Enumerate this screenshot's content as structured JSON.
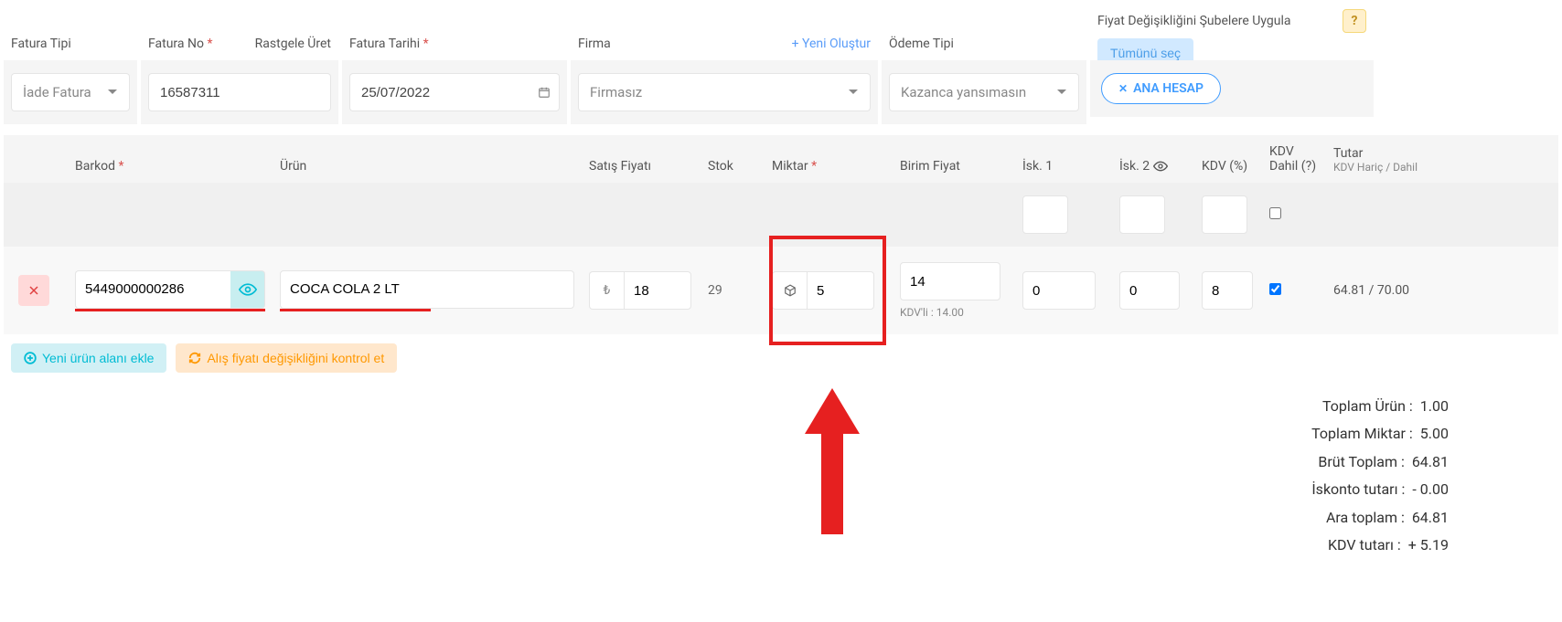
{
  "form": {
    "fatura_tipi_label": "Fatura Tipi",
    "fatura_tipi_value": "İade Fatura",
    "fatura_no_label": "Fatura No",
    "rastgele_uret": "Rastgele Üret",
    "fatura_no_value": "16587311",
    "fatura_tarihi_label": "Fatura Tarihi",
    "fatura_tarihi_value": "25/07/2022",
    "firma_label": "Firma",
    "yeni_olustur": "+ Yeni Oluştur",
    "firma_placeholder": "Firmasız",
    "odeme_tipi_label": "Ödeme Tipi",
    "odeme_tipi_value": "Kazanca yansımasın",
    "fiyat_degisikligi": "Fiyat Değişikliğini Şubelere Uygula",
    "tumunu_sec": "Tümünü seç",
    "ana_hesap": "ANA HESAP",
    "help": "?"
  },
  "headers": {
    "barkod": "Barkod",
    "urun": "Ürün",
    "satis_fiyati": "Satış Fiyatı",
    "stok": "Stok",
    "miktar": "Miktar",
    "birim_fiyat": "Birim Fiyat",
    "isk1": "İsk. 1",
    "isk2": "İsk. 2",
    "kdv": "KDV (%)",
    "kdv_dahil": "KDV Dahil (?)",
    "tutar": "Tutar",
    "tutar_sub": "KDV Hariç / Dahil"
  },
  "row": {
    "barcode": "5449000000286",
    "product": "COCA COLA 2 LT",
    "sale_price": "18",
    "stock": "29",
    "qty": "5",
    "unit_price": "14",
    "kdvli": "KDV'li : 14.00",
    "isk1": "0",
    "isk2": "0",
    "kdv": "8",
    "kdv_dahil_checked": true,
    "tutar": "64.81 / 70.00"
  },
  "actions": {
    "yeni_urun": "Yeni ürün alanı ekle",
    "alis_fiyat": "Alış fiyatı değişikliğini kontrol et"
  },
  "totals": {
    "toplam_urun_l": "Toplam Ürün :",
    "toplam_urun_v": "1.00",
    "toplam_miktar_l": "Toplam Miktar :",
    "toplam_miktar_v": "5.00",
    "brut_toplam_l": "Brüt Toplam :",
    "brut_toplam_v": "64.81",
    "iskonto_l": "İskonto tutarı :",
    "iskonto_v": "- 0.00",
    "ara_toplam_l": "Ara toplam :",
    "ara_toplam_v": "64.81",
    "kdv_tutari_l": "KDV tutarı :",
    "kdv_tutari_v": "+ 5.19"
  },
  "icons": {
    "lira": "₺"
  }
}
